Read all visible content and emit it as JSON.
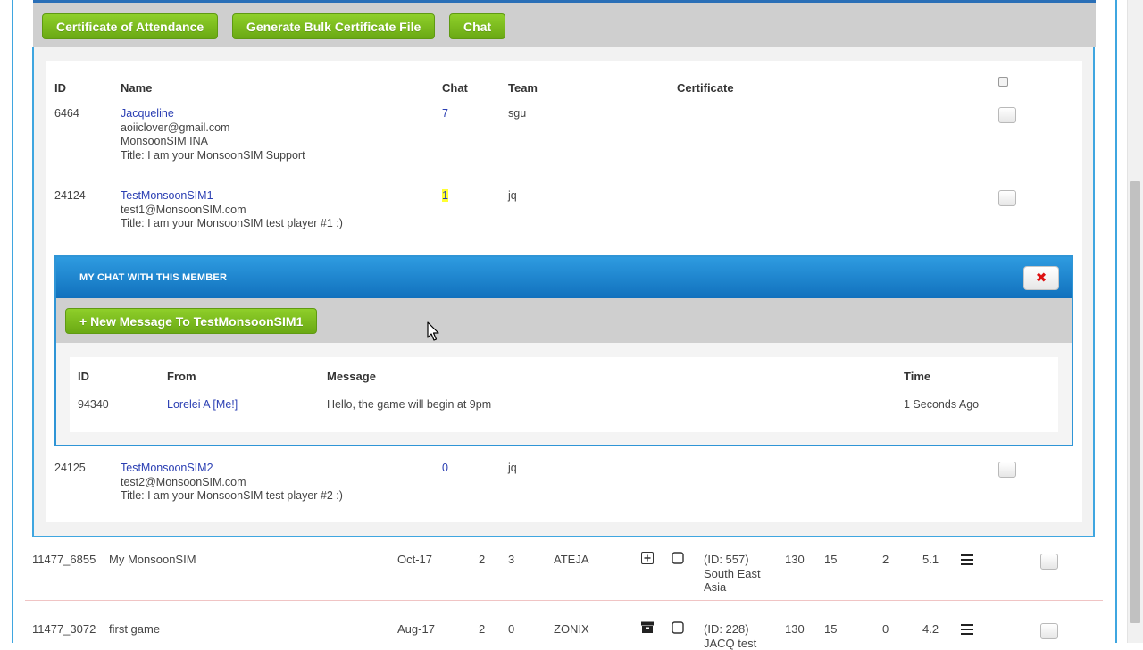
{
  "toolbar": {
    "certificate_attendance": "Certificate of Attendance",
    "bulk_certificate": "Generate Bulk Certificate File",
    "chat": "Chat"
  },
  "members": {
    "headers": {
      "id": "ID",
      "name": "Name",
      "chat": "Chat",
      "team": "Team",
      "certificate": "Certificate"
    },
    "rows": [
      {
        "id": "6464",
        "name": "Jacqueline",
        "email": "aoiiclover@gmail.com",
        "org": "MonsoonSIM INA",
        "title": "Title: I am your MonsoonSIM Support",
        "chat": "7",
        "team": "sgu"
      },
      {
        "id": "24124",
        "name": "TestMonsoonSIM1",
        "email": "test1@MonsoonSIM.com",
        "title": "Title: I am your MonsoonSIM test player #1 :)",
        "chat": "1",
        "team": "jq"
      },
      {
        "id": "24125",
        "name": "TestMonsoonSIM2",
        "email": "test2@MonsoonSIM.com",
        "title": "Title: I am your MonsoonSIM test player #2 :)",
        "chat": "0",
        "team": "jq"
      }
    ]
  },
  "chat_panel": {
    "title": "MY CHAT WITH THIS MEMBER",
    "close_icon": "close-x-icon",
    "new_message": "+ New Message To TestMonsoonSIM1",
    "headers": {
      "id": "ID",
      "from": "From",
      "message": "Message",
      "time": "Time"
    },
    "messages": [
      {
        "id": "94340",
        "from": "Lorelei A [Me!]",
        "message": "Hello, the game will begin at 9pm",
        "time": "1 Seconds Ago"
      }
    ]
  },
  "games": [
    {
      "id": "11477_6855",
      "name": "My MonsoonSIM",
      "date": "Oct-17",
      "n1": "2",
      "n2": "3",
      "company": "ATEJA",
      "icon": "plus-square-icon",
      "region_l1": "(ID: 557)",
      "region_l2": "South East",
      "region_l3": "Asia",
      "v1": "130",
      "v2": "15",
      "v3": "2",
      "v4": "5.1"
    },
    {
      "id": "11477_3072",
      "name": "first game",
      "date": "Aug-17",
      "n1": "2",
      "n2": "0",
      "company": "ZONIX",
      "icon": "archive-icon",
      "region_l1": "(ID: 228)",
      "region_l2": "JACQ test",
      "v1": "130",
      "v2": "15",
      "v3": "0",
      "v4": "4.2"
    }
  ],
  "colors": {
    "accent_blue": "#3fa6e0",
    "button_green": "#7bbd1e",
    "link": "#2b3fb3",
    "highlight": "#ffff33"
  }
}
